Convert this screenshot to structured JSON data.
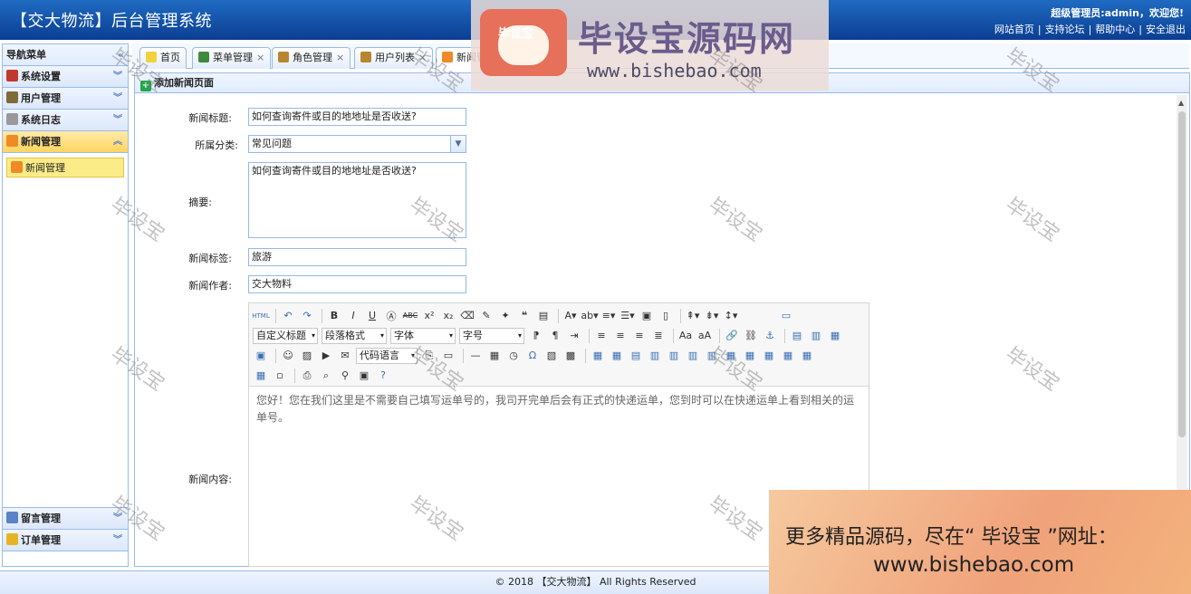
{
  "header": {
    "title": "【交大物流】后台管理系统",
    "welcome": "超级管理员:admin，欢迎您!",
    "links": [
      "网站首页",
      "支持论坛",
      "帮助中心",
      "安全退出"
    ]
  },
  "sidebar": {
    "title": "导航菜单",
    "sections_top": [
      {
        "label": "系统设置",
        "icon": "tools-icon",
        "color": "#c0392b"
      },
      {
        "label": "用户管理",
        "icon": "users-icon",
        "color": "#7f6a3a"
      },
      {
        "label": "系统日志",
        "icon": "log-icon",
        "color": "#888888"
      },
      {
        "label": "新闻管理",
        "icon": "rss-icon",
        "color": "#f08a24"
      }
    ],
    "active_item": "新闻管理",
    "sections_bottom": [
      {
        "label": "留言管理",
        "icon": "chat-icon",
        "color": "#5a82c4"
      },
      {
        "label": "订单管理",
        "icon": "order-icon",
        "color": "#e6b422"
      }
    ]
  },
  "tabs": [
    {
      "label": "首页",
      "closable": false
    },
    {
      "label": "菜单管理",
      "closable": true
    },
    {
      "label": "角色管理",
      "closable": true
    },
    {
      "label": "用户列表",
      "closable": true
    },
    {
      "label": "新闻管理",
      "closable": true
    }
  ],
  "panel": {
    "title": "添加新闻页面"
  },
  "form": {
    "title_label": "新闻标题:",
    "title_value": "如何查询寄件或目的地地址是否收送?",
    "category_label": "所属分类:",
    "category_value": "常见问题",
    "summary_label": "摘要:",
    "summary_value": "如何查询寄件或目的地地址是否收送?",
    "tags_label": "新闻标签:",
    "tags_value": "旅游",
    "author_label": "新闻作者:",
    "author_value": "交大物料",
    "content_label": "新闻内容:"
  },
  "editor": {
    "selects": [
      "自定义标题",
      "段落格式",
      "字体",
      "字号"
    ],
    "code_lang": "代码语言",
    "content": "您好！您在我们这里是不需要自己填写运单号的，我司开完单后会有正式的快递运单，您到时可以在快递运单上看到相关的运单号。"
  },
  "footer": "© 2018 【交大物流】 All Rights Reserved",
  "watermark": {
    "text": "毕设宝",
    "brand": "毕设宝源码网",
    "logo_text": "毕设宝",
    "url": "www.bishebao.com",
    "ad_line1": "更多精品源码，尽在“ 毕设宝 ”网址：",
    "ad_line2": "www.bishebao.com"
  }
}
